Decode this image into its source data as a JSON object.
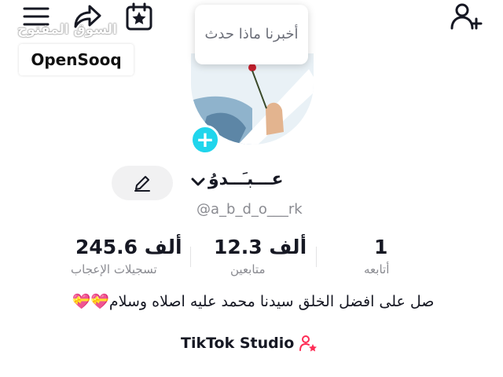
{
  "watermark": {
    "site_ar": "السوق المفتوح",
    "brand": "OpenSooq"
  },
  "note": {
    "prompt": "أخبرنا ماذا حدث"
  },
  "profile": {
    "display_name": "عـــبـَــدوُ",
    "username": "@a_b_d_o___rk"
  },
  "stats": {
    "likes": {
      "value": "245.6",
      "unit": "ألف",
      "label": "تسجيلات الإعجاب"
    },
    "followers": {
      "value": "12.3",
      "unit": "ألف",
      "label": "متابعين"
    },
    "following": {
      "value": "1",
      "label": "أتابعه"
    }
  },
  "bio": {
    "text": "صل على افضل الخلق سيدنا محمد عليه اصلاه وسلام💝💝"
  },
  "studio": {
    "label": "TikTok Studio"
  },
  "icons": {
    "menu": "menu-icon",
    "share": "share-arrow-icon",
    "calendar": "calendar-star-icon",
    "add_user": "add-user-icon",
    "edit": "pencil-icon",
    "chevron": "chevron-down-icon",
    "studio": "person-star-icon"
  },
  "colors": {
    "accent": "#20d5ec",
    "text": "#161823",
    "muted": "#8a8b91",
    "studio_icon": "#fe2c55"
  }
}
